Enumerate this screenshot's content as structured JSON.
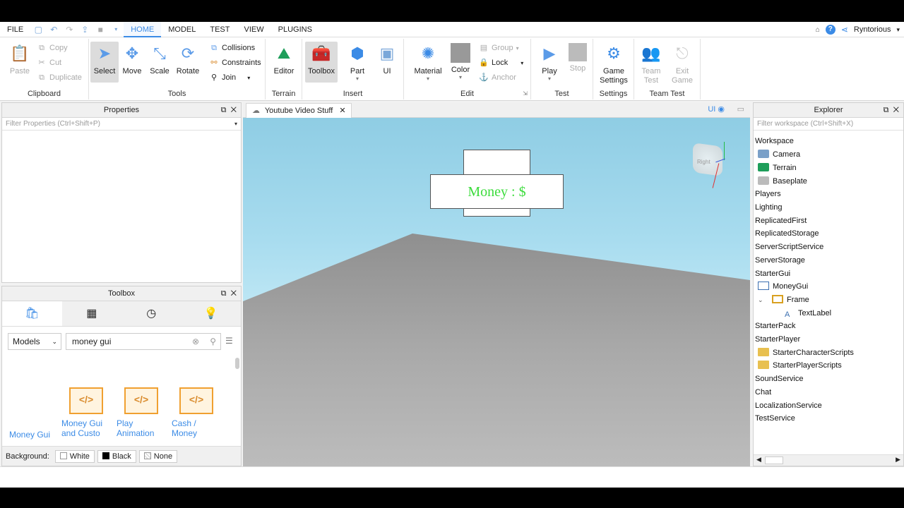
{
  "menubar": {
    "items": [
      "FILE",
      "HOME",
      "MODEL",
      "TEST",
      "VIEW",
      "PLUGINS"
    ],
    "active": "HOME",
    "username": "Ryntorious"
  },
  "ribbon": {
    "clipboard": {
      "paste": "Paste",
      "copy": "Copy",
      "cut": "Cut",
      "duplicate": "Duplicate",
      "label": "Clipboard"
    },
    "tools": {
      "select": "Select",
      "move": "Move",
      "scale": "Scale",
      "rotate": "Rotate",
      "collisions": "Collisions",
      "constraints": "Constraints",
      "join": "Join",
      "label": "Tools"
    },
    "terrain": {
      "editor": "Editor",
      "label": "Terrain"
    },
    "insert": {
      "toolbox": "Toolbox",
      "part": "Part",
      "ui": "UI",
      "label": "Insert"
    },
    "edit": {
      "material": "Material",
      "color": "Color",
      "group": "Group",
      "lock": "Lock",
      "anchor": "Anchor",
      "label": "Edit"
    },
    "test": {
      "play": "Play",
      "stop": "Stop",
      "label": "Test"
    },
    "settings": {
      "game_settings": "Game\nSettings",
      "label": "Settings"
    },
    "team_test": {
      "team_test": "Team\nTest",
      "exit_game": "Exit\nGame",
      "label": "Team Test"
    }
  },
  "properties": {
    "title": "Properties",
    "filter_placeholder": "Filter Properties (Ctrl+Shift+P)"
  },
  "toolbox": {
    "title": "Toolbox",
    "category": "Models",
    "search_value": "money gui",
    "items": [
      "Money Gui",
      "Money Gui and Custo",
      "Play Animation",
      "Cash / Money"
    ],
    "background_label": "Background:",
    "bg_options": [
      "White",
      "Black",
      "None"
    ]
  },
  "viewport": {
    "tab_title": "Youtube Video Stuff",
    "ui_toggle": "UI",
    "money_label": "Money : $",
    "cube_label": "Right"
  },
  "explorer": {
    "title": "Explorer",
    "filter_placeholder": "Filter workspace (Ctrl+Shift+X)",
    "items": [
      {
        "label": "Workspace",
        "level": 0
      },
      {
        "label": "Camera",
        "level": 1
      },
      {
        "label": "Terrain",
        "level": 1
      },
      {
        "label": "Baseplate",
        "level": 1
      },
      {
        "label": "Players",
        "level": 0
      },
      {
        "label": "Lighting",
        "level": 0
      },
      {
        "label": "ReplicatedFirst",
        "level": 0
      },
      {
        "label": "ReplicatedStorage",
        "level": 0
      },
      {
        "label": "ServerScriptService",
        "level": 0
      },
      {
        "label": "ServerStorage",
        "level": 0
      },
      {
        "label": "StarterGui",
        "level": 0
      },
      {
        "label": "MoneyGui",
        "level": 1
      },
      {
        "label": "Frame",
        "level": 2
      },
      {
        "label": "TextLabel",
        "level": 3
      },
      {
        "label": "StarterPack",
        "level": 0
      },
      {
        "label": "StarterPlayer",
        "level": 0
      },
      {
        "label": "StarterCharacterScripts",
        "level": 1
      },
      {
        "label": "StarterPlayerScripts",
        "level": 1
      },
      {
        "label": "SoundService",
        "level": 0
      },
      {
        "label": "Chat",
        "level": 0
      },
      {
        "label": "LocalizationService",
        "level": 0
      },
      {
        "label": "TestService",
        "level": 0
      }
    ]
  },
  "colors": {
    "accent": "#3b8be6",
    "money_text": "#3ddc3d"
  }
}
